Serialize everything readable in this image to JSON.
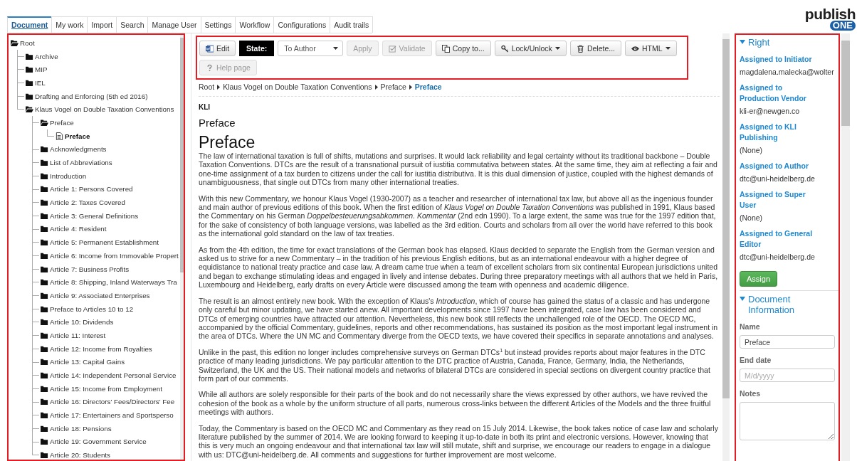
{
  "logo": {
    "word": "publish",
    "badge": "ONE"
  },
  "tabs": [
    {
      "label": "Document",
      "selected": true
    },
    {
      "label": "My work",
      "selected": false
    },
    {
      "label": "Import",
      "selected": false
    },
    {
      "label": "Search",
      "selected": false
    },
    {
      "label": "Manage User",
      "selected": false
    },
    {
      "label": "Settings",
      "selected": false
    },
    {
      "label": "Workflow",
      "selected": false
    },
    {
      "label": "Configurations",
      "selected": false
    },
    {
      "label": "Audit trails",
      "selected": false
    }
  ],
  "tree": {
    "label": "Root",
    "kind": "folder",
    "expanded": true,
    "selected": false,
    "children": [
      {
        "label": "Archive",
        "kind": "folder",
        "expanded": false,
        "selected": false
      },
      {
        "label": "MIP",
        "kind": "folder",
        "expanded": false,
        "selected": false
      },
      {
        "label": "IEL",
        "kind": "folder",
        "expanded": false,
        "selected": false
      },
      {
        "label": "Drafting and Enforcing (5th ed 2016)",
        "kind": "folder",
        "expanded": false,
        "selected": false
      },
      {
        "label": "Klaus Vogel on Double Taxation Conventions",
        "kind": "folder",
        "expanded": true,
        "selected": false,
        "children": [
          {
            "label": "Preface",
            "kind": "folder",
            "expanded": true,
            "selected": false,
            "children": [
              {
                "label": "Preface",
                "kind": "document",
                "selected": true
              }
            ]
          },
          {
            "label": "Acknowledgments",
            "kind": "folder",
            "expanded": false,
            "selected": false
          },
          {
            "label": "List of Abbreviations",
            "kind": "folder",
            "expanded": false,
            "selected": false
          },
          {
            "label": "Introduction",
            "kind": "folder",
            "expanded": false,
            "selected": false
          },
          {
            "label": "Article 1: Persons Covered",
            "kind": "folder",
            "expanded": false,
            "selected": false
          },
          {
            "label": "Article 2: Taxes Covered",
            "kind": "folder",
            "expanded": false,
            "selected": false
          },
          {
            "label": "Article 3: General Definitions",
            "kind": "folder",
            "expanded": false,
            "selected": false
          },
          {
            "label": "Article 4: Resident",
            "kind": "folder",
            "expanded": false,
            "selected": false
          },
          {
            "label": "Article 5: Permanent Establishment",
            "kind": "folder",
            "expanded": false,
            "selected": false
          },
          {
            "label": "Article 6: Income from Immovable Propert",
            "kind": "folder",
            "expanded": false,
            "selected": false
          },
          {
            "label": "Article 7: Business Profits",
            "kind": "folder",
            "expanded": false,
            "selected": false
          },
          {
            "label": "Article 8: Shipping, Inland Waterways Tra",
            "kind": "folder",
            "expanded": false,
            "selected": false
          },
          {
            "label": "Article 9: Associated Enterprises",
            "kind": "folder",
            "expanded": false,
            "selected": false
          },
          {
            "label": "Preface to Articles 10 to 12",
            "kind": "folder",
            "expanded": false,
            "selected": false
          },
          {
            "label": "Article 10: Dividends",
            "kind": "folder",
            "expanded": false,
            "selected": false
          },
          {
            "label": "Article 11: Interest",
            "kind": "folder",
            "expanded": false,
            "selected": false
          },
          {
            "label": "Article 12: Income from Royalties",
            "kind": "folder",
            "expanded": false,
            "selected": false
          },
          {
            "label": "Article 13: Capital Gains",
            "kind": "folder",
            "expanded": false,
            "selected": false
          },
          {
            "label": "Article 14: Independent Personal Service",
            "kind": "folder",
            "expanded": false,
            "selected": false
          },
          {
            "label": "Article 15: Income from Employment",
            "kind": "folder",
            "expanded": false,
            "selected": false
          },
          {
            "label": "Article 16: Directors' Fees/Directors' Fee",
            "kind": "folder",
            "expanded": false,
            "selected": false
          },
          {
            "label": "Article 17: Entertainers and Sportsperso",
            "kind": "folder",
            "expanded": false,
            "selected": false
          },
          {
            "label": "Article 18: Pensions",
            "kind": "folder",
            "expanded": false,
            "selected": false
          },
          {
            "label": "Article 19: Government Service",
            "kind": "folder",
            "expanded": false,
            "selected": false
          },
          {
            "label": "Article 20: Students",
            "kind": "folder",
            "expanded": false,
            "selected": false
          }
        ]
      }
    ]
  },
  "toolbar": [
    {
      "kind": "word",
      "label": "Edit",
      "disabled": false,
      "dropdown": false
    },
    {
      "kind": "state-label",
      "label": "State:"
    },
    {
      "kind": "select",
      "value": "To Author"
    },
    {
      "kind": "plain",
      "label": "Apply",
      "disabled": true,
      "dropdown": false
    },
    {
      "kind": "check",
      "label": "Validate",
      "disabled": true,
      "dropdown": false
    },
    {
      "kind": "copy",
      "label": "Copy to...",
      "disabled": false,
      "dropdown": false
    },
    {
      "kind": "key",
      "label": "Lock/Unlock",
      "disabled": false,
      "dropdown": true
    },
    {
      "kind": "trash",
      "label": "Delete...",
      "disabled": false,
      "dropdown": false
    },
    {
      "kind": "eye",
      "label": "HTML",
      "disabled": false,
      "dropdown": true
    },
    {
      "kind": "help",
      "label": "Help page",
      "disabled": true,
      "dropdown": false
    }
  ],
  "breadcrumb": [
    {
      "label": "Root",
      "current": false
    },
    {
      "label": "Klaus Vogel on Double Taxation Conventions",
      "current": false
    },
    {
      "label": "Preface",
      "current": false
    },
    {
      "label": "Preface",
      "current": true
    }
  ],
  "document": {
    "code": "KLI",
    "subtitle": "Preface",
    "title": "Preface",
    "paragraphs": [
      "The law of international taxation is full of shifts, mutations and surprises. It would lack reliability and legal certainty without its traditional backbone – Double Taxation Conventions. DTCs are the result of a transnational pursuit of iustitia commutativa between states. At the same time, they aim at reflecting a fair and one-time assignment of a tax burden to citizens under the call for iustitia distributiva. It is this dual dimension of justice, coupled with the highest demands of unambiguousness, that single out DTCs from many other international treaties.",
      "With this new Commentary, we honour Klaus Vogel (1930-2007) as a teacher and researcher of international tax law, but above all as the ingenious founder and main author of previous editions of this book. When the first edition of *Klaus Vogel on Double Taxation Conventions* was published in 1991, Klaus based the Commentary on his German *Doppelbesteuerungsabkommen. Kommentar* (2nd edn 1990). To a large extent, the same was true for the 1997 edition that, for the sake of consistency of both language versions, was labelled as the 3rd edition. Courts and scholars from all over the world have referred to this book as the international gold standard on the law of tax treaties.",
      "As from the 4th edition, the time for exact translations of the German book has elapsed. Klaus decided to separate the English from the German version and asked us to strive for a new Commentary – in the tradition of his previous English editions, but as an international endeavour with a higher degree of equidistance to national treaty practice and case law. A dream came true when a team of excellent scholars from six continental European jurisdictions united and began to exchange stimulating ideas and engaged in lively and intense debates. During three preparatory meetings with all authors that we held in Paris, Luxembourg and Heidelberg, early drafts on every Article were discussed among the team with openness and academic diligence.",
      "The result is an almost entirely new book. With the exception of Klaus's *Introduction*, which of course has gained the status of a classic and has undergone only careful but minor updating, we have started anew. All important developments since 1997 have been integrated, case law has been considered and DTCs of emerging countries have attracted our attention. Nevertheless, this new book still reflects the unchallenged role of the OECD. The OECD MC, accompanied by the official Commentary, guidelines, reports and other recommendations, has sustained its position as the most important legal instrument in the area of DTCs. Where the UN MC and Commentary diverge from the OECD texts, we have covered their specifics in separate annotations and analyses.",
      "Unlike in the past, this edition no longer includes comprehensive surveys on German DTCs$^{1}$ but instead provides reports about major features in the DTC practice of many leading jurisdictions. We pay particular attention to the DTC practice of Austria, Canada, France, Germany, India, the Netherlands, Switzerland, the UK and the US. Their national models and networks of bilateral DTCs are considered in special sections on divergent country practice that form part of our comments.",
      "While all authors are solely responsible for their parts of the book and do not necessarily share the views expressed by other authors, we have revived the cohesion of the book as a whole by the uniform structure of all parts, numerous cross-links between the different Articles of the Models and the three fruitful meetings with authors.",
      "Today, the Commentary is based on the OECD MC and Commentary as they read on 15 July 2014. Likewise, the book takes notice of case law and scholarly literature published by the summer of 2014. We are looking forward to keeping it up-to-date in both its print and electronic versions. However, knowing that this is very much an ongoing endeavour and that international tax law will still mutate, shift and surprise, we encourage our readers to engage in a dialogue with us: DTC@uni-heidelberg.de. All comments and suggestions for further improvement are most welcome."
    ]
  },
  "sidebar": {
    "right_section": {
      "title": "Right",
      "expanded": true,
      "assignments": [
        {
          "label": "Assigned to Initiator",
          "value": "magdalena.malecka@wolter"
        },
        {
          "label": "Assigned to Production Vendor",
          "value": "kli-er@newgen.co"
        },
        {
          "label": "Assigned to KLI Publishing",
          "value": "(None)"
        },
        {
          "label": "Assigned to Author",
          "value": "dtc@uni-heidelberg.de"
        },
        {
          "label": "Assigned to Super User",
          "value": "(None)"
        },
        {
          "label": "Assigned to General Editor",
          "value": "dtc@uni-heidelberg.de"
        }
      ],
      "button": "Assign"
    },
    "info_section": {
      "title": "Document Information",
      "expanded": true,
      "fields": [
        {
          "label": "Name",
          "kind": "text",
          "value": "Preface"
        },
        {
          "label": "End date",
          "kind": "text",
          "placeholder": "M/d/yyyy"
        },
        {
          "label": "Notes",
          "kind": "textarea"
        }
      ]
    }
  }
}
